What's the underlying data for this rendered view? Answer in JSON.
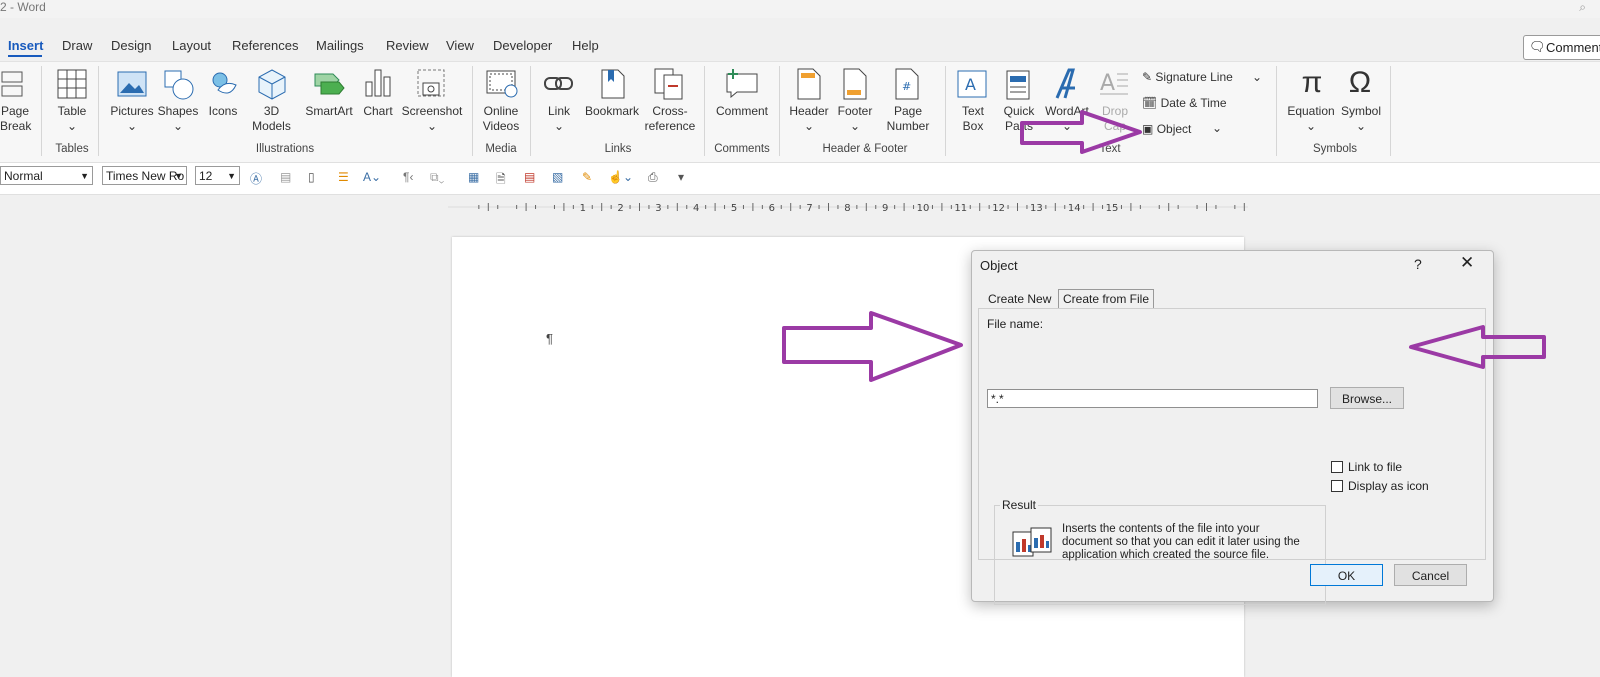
{
  "window": {
    "title": "2  -  Word"
  },
  "tabs": [
    "Insert",
    "Draw",
    "Design",
    "Layout",
    "References",
    "Mailings",
    "Review",
    "View",
    "Developer",
    "Help"
  ],
  "comments_button": "Comments",
  "ribbon": {
    "page_break": [
      "Page",
      "Break"
    ],
    "table": "Table",
    "pictures": "Pictures",
    "shapes": "Shapes",
    "icons": "Icons",
    "models": [
      "3D",
      "Models"
    ],
    "smartart": "SmartArt",
    "chart": "Chart",
    "screenshot": "Screenshot",
    "online_videos": [
      "Online",
      "Videos"
    ],
    "link": "Link",
    "bookmark": "Bookmark",
    "cross_reference": [
      "Cross-",
      "reference"
    ],
    "comment": "Comment",
    "header": "Header",
    "footer": "Footer",
    "page_number": [
      "Page",
      "Number"
    ],
    "text_box": [
      "Text",
      "Box"
    ],
    "quick_parts": [
      "Quick",
      "Parts"
    ],
    "wordart": "WordArt",
    "drop_cap": [
      "Drop",
      "Cap"
    ],
    "signature_line": "Signature Line",
    "date_time": "Date & Time",
    "object": "Object",
    "equation": "Equation",
    "symbol": "Symbol",
    "groups": [
      "Tables",
      "Illustrations",
      "Media",
      "Links",
      "Comments",
      "Header & Footer",
      "Text",
      "Symbols"
    ]
  },
  "format_bar": {
    "style": "Normal",
    "font": "Times New Ro",
    "size": "12"
  },
  "ruler": [
    "1",
    "2",
    "3",
    "4",
    "5",
    "6",
    "7",
    "8",
    "9",
    "10",
    "11",
    "12",
    "13",
    "14",
    "15"
  ],
  "dialog": {
    "title": "Object",
    "help": "?",
    "close": "✕",
    "tab_new": "Create New",
    "tab_file": "Create from File",
    "file_name_label": "File name:",
    "file_name_value": "*.*",
    "browse": "Browse...",
    "link_to_file": "Link to file",
    "display_as_icon": "Display as icon",
    "result_label": "Result",
    "result_text": "Inserts the contents of the file into your document so that you can edit it later using the application which created the source file.",
    "ok": "OK",
    "cancel": "Cancel"
  },
  "annotation_color": "#9b3aa5"
}
